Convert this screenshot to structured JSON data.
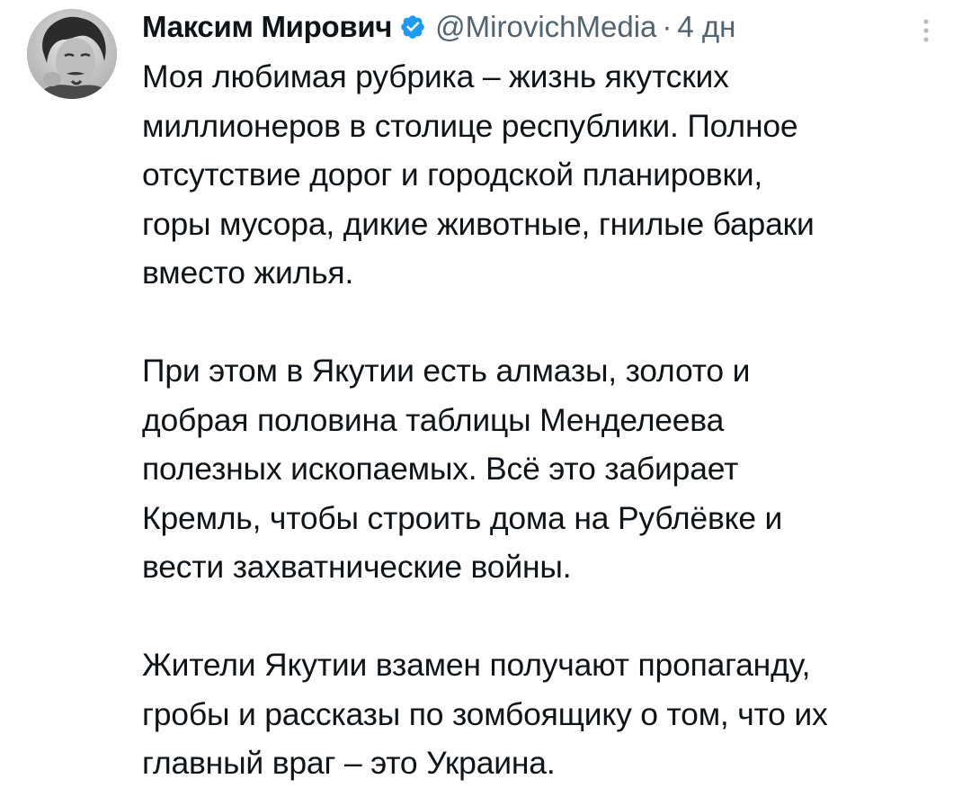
{
  "author": {
    "display_name": "Максим Мирович",
    "handle": "@MirovichMedia",
    "separator": "·",
    "timestamp": "4 дн",
    "verified_icon": "verified-badge-icon",
    "avatar_icon": "avatar-photo"
  },
  "menu": {
    "icon": "more-vertical-icon"
  },
  "colors": {
    "text": "#0f1419",
    "secondary": "#536471",
    "verified": "#1d9bf0",
    "background": "#ffffff"
  },
  "tweet": {
    "paragraphs": [
      {
        "lines": [
          "Моя любимая рубрика – жизнь якутских",
          "миллионеров в столице республики. Полное",
          "отсутствие дорог и городской планировки,",
          "горы мусора, дикие животные, гнилые бараки",
          "вместо жилья."
        ]
      },
      {
        "lines": [
          "При этом в Якутии есть алмазы, золото и",
          "добрая половина таблицы Менделеева",
          "полезных ископаемых. Всё это забирает",
          "Кремль, чтобы строить дома на Рублёвке и",
          "вести захватнические войны."
        ]
      },
      {
        "lines": [
          "Жители Якутии взамен получают пропаганду,",
          "гробы и рассказы по зомбоящику о том, что их",
          "главный враг – это Украина."
        ]
      }
    ]
  }
}
